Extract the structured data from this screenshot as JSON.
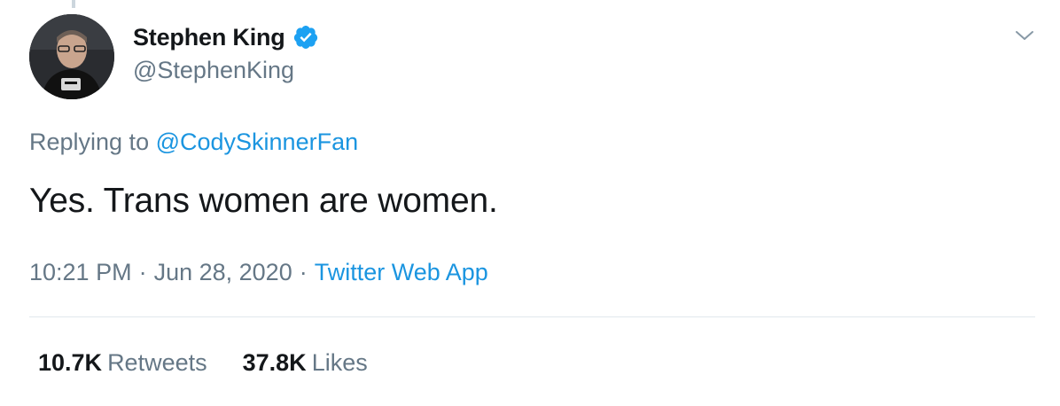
{
  "tweet": {
    "author": {
      "display_name": "Stephen King",
      "handle": "@StephenKing",
      "verified": true,
      "avatar_icon": "avatar-photo"
    },
    "reply_prefix": "Replying to ",
    "reply_handle": "@CodySkinnerFan",
    "text": "Yes. Trans women are women.",
    "time": "10:21 PM",
    "separator": "·",
    "date": "Jun 28, 2020",
    "source": "Twitter Web App",
    "stats": {
      "retweets_count": "10.7K",
      "retweets_label": "Retweets",
      "likes_count": "37.8K",
      "likes_label": "Likes"
    }
  },
  "icons": {
    "verified": "verified-badge-icon",
    "menu": "chevron-down-icon"
  },
  "colors": {
    "accent": "#1b95e0",
    "text_primary": "#14171a",
    "text_secondary": "#657786",
    "verified": "#1da1f2",
    "divider": "#e1e8ed"
  }
}
